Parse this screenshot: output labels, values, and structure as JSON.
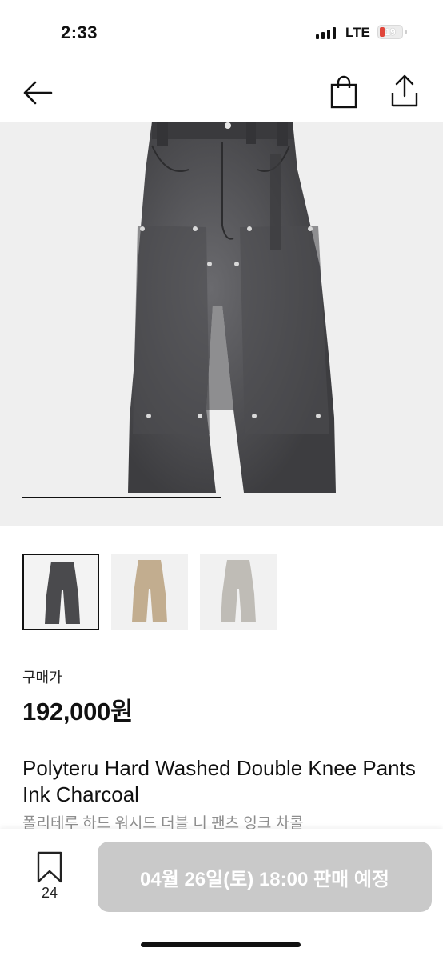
{
  "status_bar": {
    "time": "2:33",
    "carrier": "LTE",
    "battery_level": "19",
    "battery_color": "#e0453a"
  },
  "nav": {
    "back_icon": "arrow-left-icon",
    "bag_icon": "shopping-bag-icon",
    "share_icon": "share-icon"
  },
  "gallery": {
    "image": "charcoal-double-knee-pants",
    "progress": 0.5,
    "thumbnails": [
      {
        "variant": "charcoal",
        "color": "#4a4a4d",
        "selected": true
      },
      {
        "variant": "tan",
        "color": "#c2ad8f",
        "selected": false
      },
      {
        "variant": "light-grey",
        "color": "#bfbcb6",
        "selected": false
      }
    ]
  },
  "product": {
    "price_label": "구매가",
    "price": "192,000원",
    "title_en": "Polyteru Hard Washed Double Knee Pants Ink Charcoal",
    "title_ko": "폴리테루 하드 워시드 더블 니 팬츠 잉크 차콜"
  },
  "bottom_bar": {
    "wish_icon": "bookmark-icon",
    "wish_count": "24",
    "cta_label": "04월 26일(토) 18:00 판매 예정",
    "cta_color": "#c9c9c9"
  }
}
